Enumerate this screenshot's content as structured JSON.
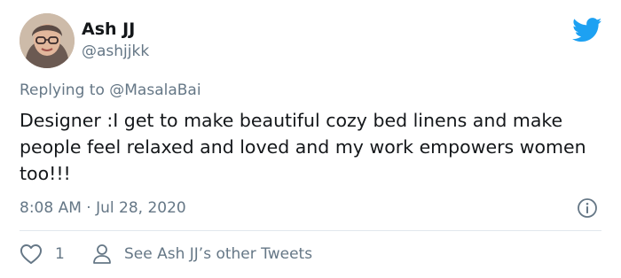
{
  "author": {
    "name": "Ash JJ",
    "handle": "@ashjjkk"
  },
  "reply": {
    "prefix": "Replying to ",
    "to_handle": "@MasalaBai"
  },
  "tweet": {
    "text": "Designer :I get to make beautiful cozy bed linens and make people feel relaxed and loved and my work empowers women too!!!",
    "timestamp": "8:08 AM · Jul 28, 2020"
  },
  "actions": {
    "like_count": "1",
    "other_tweets_label": "See Ash JJ’s other Tweets"
  },
  "icons": {
    "brand": "twitter-bird-icon",
    "info": "info-icon",
    "like": "heart-icon",
    "profile": "person-icon"
  },
  "colors": {
    "brand_blue": "#1da1f2",
    "secondary_text": "#657786",
    "primary_text": "#14171a",
    "divider": "#e1e8ed"
  }
}
